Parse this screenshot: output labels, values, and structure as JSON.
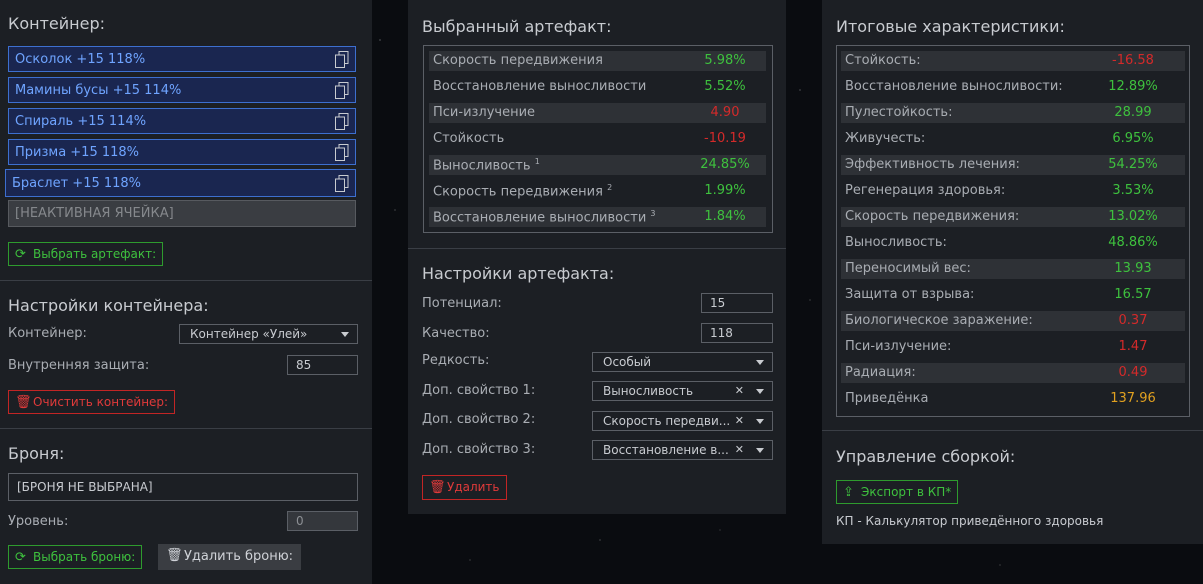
{
  "container": {
    "title": "Контейнер:",
    "slots": [
      {
        "label": "Осколок +15 118%"
      },
      {
        "label": "Мамины бусы +15 114%"
      },
      {
        "label": "Спираль +15 114%"
      },
      {
        "label": "Призма +15 118%"
      },
      {
        "label": "Браслет +15 118%"
      }
    ],
    "inactive_slot": "[НЕАКТИВНАЯ ЯЧЕЙКА]",
    "choose_button": "Выбрать артефакт:"
  },
  "container_settings": {
    "title": "Настройки контейнера:",
    "container_label": "Контейнер:",
    "container_value": "Контейнер «Улей»",
    "protection_label": "Внутренняя защита:",
    "protection_value": "85",
    "clear_button": "Очистить контейнер:"
  },
  "armor": {
    "title": "Броня:",
    "field_value": "[БРОНЯ НЕ ВЫБРАНА]",
    "level_label": "Уровень:",
    "level_value": "0",
    "choose_button": "Выбрать броню:",
    "delete_button": "Удалить броню:"
  },
  "selected_artifact": {
    "title": "Выбранный артефакт:",
    "stats": [
      {
        "label": "Скорость передвижения",
        "sup": "",
        "value": "5.98%",
        "color": "#3ec13e"
      },
      {
        "label": "Восстановление выносливости",
        "sup": "",
        "value": "5.52%",
        "color": "#3ec13e"
      },
      {
        "label": "Пси-излучение",
        "sup": "",
        "value": "4.90",
        "color": "#d42a2a"
      },
      {
        "label": "Стойкость",
        "sup": "",
        "value": "-10.19",
        "color": "#d42a2a"
      },
      {
        "label": "Выносливость",
        "sup": "1",
        "value": "24.85%",
        "color": "#3ec13e"
      },
      {
        "label": "Скорость передвижения",
        "sup": "2",
        "value": "1.99%",
        "color": "#3ec13e"
      },
      {
        "label": "Восстановление выносливости",
        "sup": "3",
        "value": "1.84%",
        "color": "#3ec13e"
      }
    ]
  },
  "artifact_settings": {
    "title": "Настройки артефакта:",
    "potential_label": "Потенциал:",
    "potential_value": "15",
    "quality_label": "Качество:",
    "quality_value": "118",
    "rarity_label": "Редкость:",
    "rarity_value": "Особый",
    "extra1_label": "Доп. свойство 1:",
    "extra1_value": "Выносливость",
    "extra2_label": "Доп. свойство 2:",
    "extra2_value": "Скорость передви...",
    "extra3_label": "Доп. свойство 3:",
    "extra3_value": "Восстановление в...",
    "delete_button": "Удалить"
  },
  "totals": {
    "title": "Итоговые характеристики:",
    "stats": [
      {
        "label": "Стойкость:",
        "value": "-16.58",
        "color": "#d42a2a"
      },
      {
        "label": "Восстановление выносливости:",
        "value": "12.89%",
        "color": "#3ec13e"
      },
      {
        "label": "Пулестойкость:",
        "value": "28.99",
        "color": "#3ec13e"
      },
      {
        "label": "Живучесть:",
        "value": "6.95%",
        "color": "#3ec13e"
      },
      {
        "label": "Эффективность лечения:",
        "value": "54.25%",
        "color": "#3ec13e"
      },
      {
        "label": "Регенерация здоровья:",
        "value": "3.53%",
        "color": "#3ec13e"
      },
      {
        "label": "Скорость передвижения:",
        "value": "13.02%",
        "color": "#3ec13e"
      },
      {
        "label": "Выносливость:",
        "value": "48.86%",
        "color": "#3ec13e"
      },
      {
        "label": "Переносимый вес:",
        "value": "13.93",
        "color": "#3ec13e"
      },
      {
        "label": "Защита от взрыва:",
        "value": "16.57",
        "color": "#3ec13e"
      },
      {
        "label": "Биологическое заражение:",
        "value": "0.37",
        "color": "#d42a2a"
      },
      {
        "label": "Пси-излучение:",
        "value": "1.47",
        "color": "#d42a2a"
      },
      {
        "label": "Радиация:",
        "value": "0.49",
        "color": "#d42a2a"
      },
      {
        "label": "Приведёнка",
        "value": "137.96",
        "color": "#e0a020"
      }
    ]
  },
  "build": {
    "title": "Управление сборкой:",
    "export_button": "Экспорт в КП*",
    "note": "КП - Калькулятор приведённого здоровья"
  }
}
